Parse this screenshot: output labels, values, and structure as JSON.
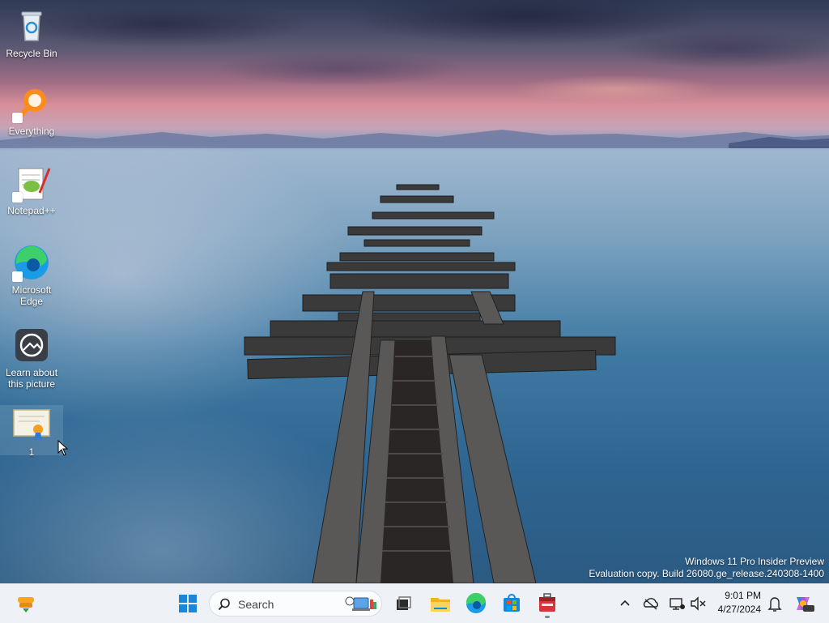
{
  "desktop": {
    "icons": [
      {
        "label": "Recycle Bin",
        "icon": "recycle-bin-icon"
      },
      {
        "label": "Everything",
        "icon": "everything-search-icon"
      },
      {
        "label": "Notepad++",
        "icon": "notepadpp-icon"
      },
      {
        "label": "Microsoft Edge",
        "icon": "edge-icon"
      },
      {
        "label": "Learn about this picture",
        "icon": "learn-picture-icon"
      },
      {
        "label": "1",
        "icon": "certificate-icon"
      }
    ]
  },
  "watermark": {
    "line1": "Windows 11 Pro Insider Preview",
    "line2": "Evaluation copy. Build 26080.ge_release.240308-1400"
  },
  "taskbar": {
    "search_label": "Search",
    "pinned": [
      "widgets-icon",
      "start-icon",
      "task-view-icon",
      "file-explorer-icon",
      "edge-icon",
      "store-icon",
      "toolbox-icon"
    ],
    "tray": {
      "time": "9:01 PM",
      "date": "4/27/2024",
      "icons": [
        "chevron-up-icon",
        "onedrive-offline-icon",
        "network-icon",
        "volume-muted-icon",
        "notification-bell-icon",
        "copilot-icon"
      ]
    }
  },
  "colors": {
    "taskbar_bg": "#eef1f6",
    "accent": "#0067c0"
  }
}
